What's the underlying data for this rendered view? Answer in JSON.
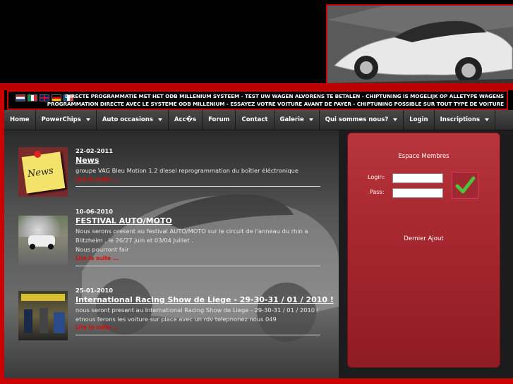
{
  "header": {
    "tagline_nl": "DIRECTE PROGRAMMATIE MET HET ODB MILLENIUM SYSTEEM - TEST UW WAGEN ALVORENS TE BETALEN - CHIPTUNING IS MOGELIJK OP ALLETYPE WAGENS",
    "tagline_fr": "PROGRAMMATION DIRECTE AVEC LE SYSTEME ODB MILLENIUM - ESSAYEZ VOTRE VOITURE AVANT DE PAYER - CHIPTUNING POSSIBLE SUR TOUT TYPE DE VOITURE",
    "flags": [
      "nl-flag-icon",
      "it-flag-icon",
      "uk-flag-icon",
      "de-flag-icon",
      "fr-flag-icon"
    ]
  },
  "nav": [
    {
      "label": "Home",
      "dropdown": false
    },
    {
      "label": "PowerChips",
      "dropdown": true
    },
    {
      "label": "Auto occasions",
      "dropdown": true
    },
    {
      "label": "Acc�s",
      "dropdown": false
    },
    {
      "label": "Forum",
      "dropdown": false
    },
    {
      "label": "Contact",
      "dropdown": false
    },
    {
      "label": "Galerie",
      "dropdown": true
    },
    {
      "label": "Qui sommes nous?",
      "dropdown": true
    },
    {
      "label": "Login",
      "dropdown": false
    },
    {
      "label": "Inscriptions",
      "dropdown": true
    }
  ],
  "articles": [
    {
      "date": "22-02-2011",
      "title": "News",
      "body": [
        "groupe VAG Bleu Motion 1.2 diesel reprogrammation du boîtier éléctronique"
      ],
      "more": "Lire la suite ..."
    },
    {
      "date": "10-06-2010",
      "title": "FESTIVAL AUTO/MOTO",
      "body": [
        "Nous serons present au festival AUTO/MOTO sur le circuit de l'anneau du rhin a",
        "Blitzheim , le 26/27 juin et 03/04 Juillet .",
        "Nous pourront fair"
      ],
      "more": "Lire la suite ..."
    },
    {
      "date": "25-01-2010",
      "title": "International Racing Show de Liege - 29-30-31 / 01 / 2010 !",
      "body": [
        "nous seront present au International Racing Show de Liege - 29-30-31 / 01 / 2010 !",
        "etnous ferons les voiture sur place avec un rdv telepnonez nous 049"
      ],
      "more": "Lire la suite ..."
    }
  ],
  "thumb_text": {
    "news_note": "News"
  },
  "member": {
    "title": "Espace Membres",
    "login_label": "Login:",
    "pass_label": "Pass:",
    "login_value": "",
    "pass_value": "",
    "latest_title": "Dernier Ajout"
  },
  "colors": {
    "accent": "#cc0000",
    "link_red": "#ee0000",
    "panel": "#a8282f"
  }
}
